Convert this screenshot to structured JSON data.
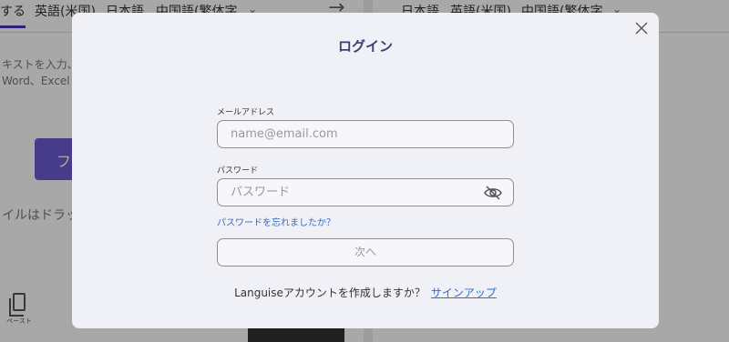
{
  "background": {
    "source_langs": [
      "する",
      "英語(米国)",
      "日本語",
      "中国語(繁体字"
    ],
    "target_langs": [
      "日本語",
      "英語(米国)",
      "中国語(繁体字"
    ],
    "source_hint_line1": "キストを入力、",
    "source_hint_line2": "Word、Excel",
    "file_button_label": "フ",
    "drop_hint": "イルはドラッ",
    "paste_label": "ペースト"
  },
  "modal": {
    "title": "ログイン",
    "email_label": "メールアドレス",
    "email_placeholder": "name@email.com",
    "email_value": "",
    "password_label": "パスワード",
    "password_placeholder": "パスワード",
    "password_value": "",
    "forgot_link": "パスワードを忘れましたか？",
    "next_button": "次へ",
    "signup_prompt": "Languiseアカウントを作成しますか？",
    "signup_link": "サインアップ"
  },
  "icons": {
    "close": "close-icon",
    "eye": "eye-off-icon",
    "paste": "paste-icon",
    "arrow": "arrow-right-icon",
    "chevron": "chevron-down-icon"
  },
  "colors": {
    "modal_bg": "#f0f0f7",
    "title": "#3e3e73",
    "link": "#2f6dd2",
    "accent": "#4a2fb0"
  }
}
